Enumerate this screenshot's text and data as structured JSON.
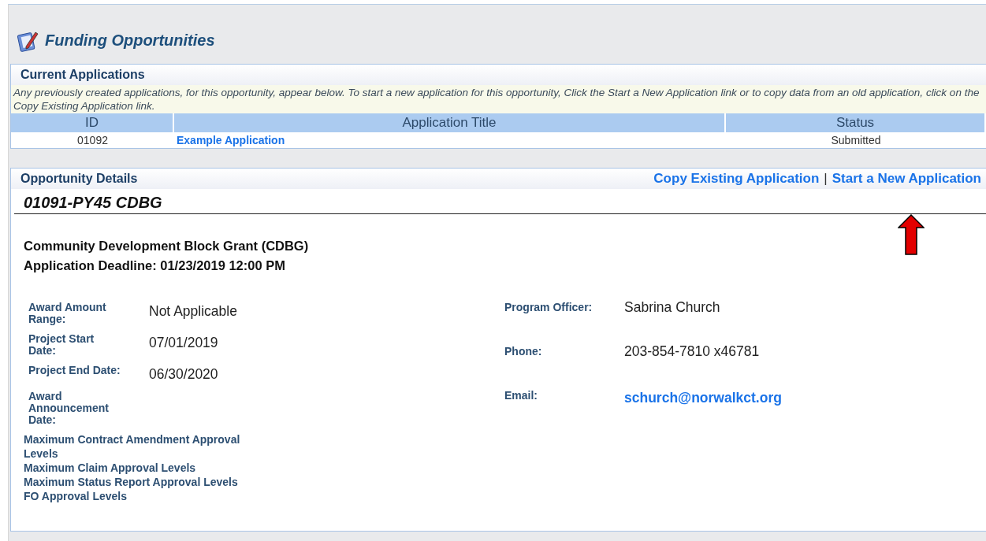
{
  "page": {
    "title": "Funding Opportunities"
  },
  "current_applications": {
    "heading": "Current Applications",
    "note": "Any previously created applications, for this opportunity, appear below. To start a new application for this opportunity, Click the Start a New Application link or to copy data from an old application, click on the Copy Existing Application link.",
    "columns": [
      "ID",
      "Application Title",
      "Status"
    ],
    "rows": [
      {
        "id": "01092",
        "title": "Example Application",
        "status": "Submitted"
      }
    ]
  },
  "opportunity_details": {
    "heading": "Opportunity Details",
    "links": [
      "Copy Existing Application",
      "Start a New Application"
    ],
    "separator": "|",
    "code": "01091-PY45 CDBG",
    "name": "Community Development Block Grant (CDBG)",
    "deadline": "Application Deadline: 01/23/2019 12:00 PM",
    "left_fields": [
      {
        "label": "Award Amount Range:",
        "value": "Not Applicable"
      },
      {
        "label": "Project Start Date:",
        "value": "07/01/2019"
      },
      {
        "label": "Project End Date:",
        "value": "06/30/2020"
      },
      {
        "label": "Award Announcement Date:"
      }
    ],
    "right_fields": [
      {
        "label": "Program Officer:",
        "value": "Sabrina Church",
        "kind": "text"
      },
      {
        "label": "Phone:",
        "value": "203-854-7810 x46781",
        "kind": "text"
      },
      {
        "label": "Email:",
        "value": "schurch@norwalkct.org",
        "kind": "link"
      }
    ],
    "approval_levels": [
      "Maximum Contract Amendment Approval Levels",
      "Maximum Claim Approval Levels",
      "Maximum Status Report Approval Levels",
      "FO Approval Levels"
    ]
  }
}
